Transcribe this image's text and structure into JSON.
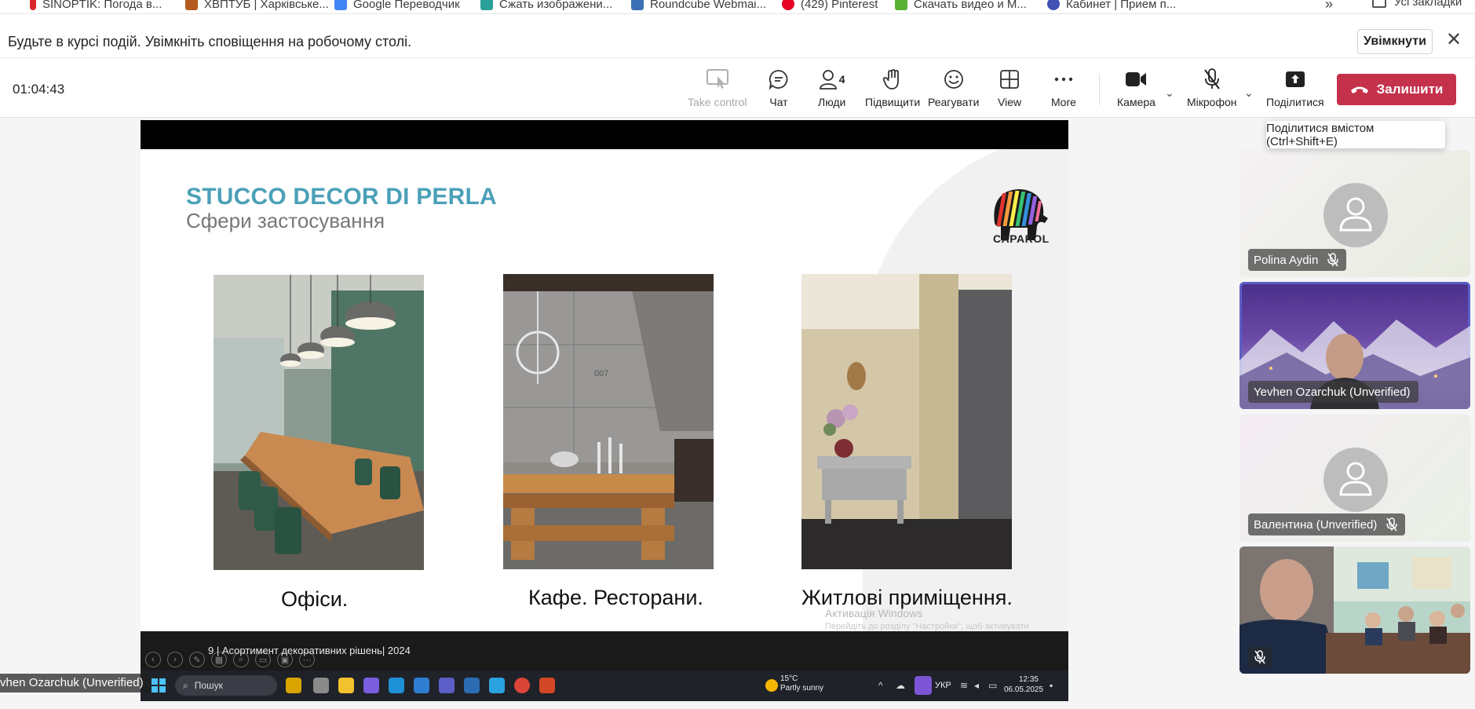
{
  "bookmarks": [
    {
      "label": "SINOPTIK: Погода в...",
      "color": "#d9262c"
    },
    {
      "label": "ХВПТУБ | Харківське...",
      "color": "#b45a1e"
    },
    {
      "label": "Google Переводчик",
      "color": "#4285f4"
    },
    {
      "label": "Сжать изображени...",
      "color": "#2aa198"
    },
    {
      "label": "Roundcube Webmai...",
      "color": "#3d6fb6"
    },
    {
      "label": "(429) Pinterest",
      "color": "#e60023"
    },
    {
      "label": "Скачать видео и М...",
      "color": "#5ab034"
    },
    {
      "label": "Кабинет | Прием п...",
      "color": "#3f51b5"
    }
  ],
  "bookmarks_more": "»",
  "bookmarks_all": "Усі закладки",
  "notification": {
    "text": "Будьте в курсі подій. Увімкніть сповіщення на робочому столі.",
    "button": "Увімкнути",
    "close": "✕"
  },
  "toolbar": {
    "timer": "01:04:43",
    "take_control": "Take control",
    "chat": "Чат",
    "people": "Люди",
    "people_count": "4",
    "raise": "Підвищити",
    "react": "Реагувати",
    "view": "View",
    "more": "More",
    "camera": "Камера",
    "mic": "Мікрофон",
    "share": "Поділитися",
    "leave": "Залишити",
    "accent": "#5b5fc7",
    "leave_color": "#c4314b"
  },
  "tooltip": "Поділитися вмістом (Ctrl+Shift+E)",
  "slide": {
    "title": "STUCCO DECOR DI PERLA",
    "subtitle": "Сфери застосування",
    "logo_text": "CAPAROL",
    "captions": [
      "Офіси.",
      "Кафе. Ресторани.",
      "Житлові приміщення."
    ],
    "photo_number": "007",
    "footer": "9  | Асортимент декоративних рішень| 2024",
    "title_color": "#4ba0b8"
  },
  "windows_activation": {
    "line1": "Активація Windows",
    "line2": "Перейдіть до розділу \"Настройки\", щоб активувати Windows."
  },
  "taskbar": {
    "search": "Пошук",
    "temperature": "15°C",
    "weather": "Partly sunny",
    "language": "УКР",
    "time": "12:35",
    "date": "06.05.2025"
  },
  "presenter_name": "vhen Ozarchuk (Unverified)",
  "participants": [
    {
      "name": "Polina Aydin",
      "type": "avatar"
    },
    {
      "name": "Yevhen Ozarchuk (Unverified)",
      "type": "video"
    },
    {
      "name": "Валентина (Unverified)",
      "type": "avatar"
    },
    {
      "name": "",
      "type": "video-muted"
    }
  ]
}
